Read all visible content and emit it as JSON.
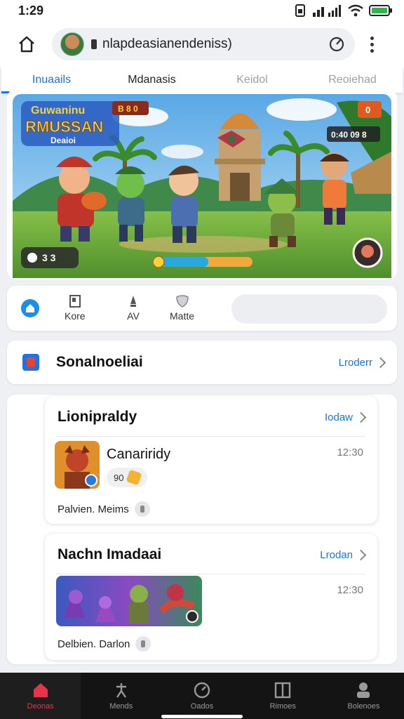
{
  "status_bar": {
    "time": "1:29",
    "icons": [
      "sim-icon",
      "signal-icon",
      "wifi-icon",
      "battery-icon"
    ]
  },
  "browser": {
    "url": "nlapdeasianendeniss)",
    "icons": [
      "home-icon",
      "site-avatar",
      "lock-icon",
      "refresh-icon",
      "more-vert-icon"
    ]
  },
  "tabs": [
    {
      "label": "Inuaails"
    },
    {
      "label": "Mdanasis"
    },
    {
      "label": "Keidol"
    },
    {
      "label": "Reoiehad"
    }
  ],
  "hero": {
    "logo_line1": "Guwaninu",
    "logo_line2": "RMUSSAN",
    "logo_line3": "Deaioi",
    "top_badge": "B 8 0",
    "score_badge": "0:40 09 8",
    "corner_badge": "0",
    "counter_badge": "3 3",
    "progress": 0.55,
    "colors": {
      "sky": "#6fb6e8",
      "grass": "#6aa83a",
      "progress_fill": "#29a8e0",
      "progress_track": "#f2a93b"
    }
  },
  "quick_actions": {
    "items": [
      {
        "label": "Kore",
        "icon": "book-icon"
      },
      {
        "label": "AV",
        "icon": "pen-icon"
      },
      {
        "label": "Matte",
        "icon": "shield-icon"
      }
    ],
    "home_icon": "home-icon",
    "search_placeholder": ""
  },
  "section": {
    "title": "Sonalnoeliai",
    "link": "Lroderr"
  },
  "cards": [
    {
      "title": "Lionipraldy",
      "link": "Iodaw",
      "item_name": "Canariridy",
      "time": "12:30",
      "tag": "90",
      "footer": "Palvien. Meims"
    },
    {
      "title": "Nachn Imadaai",
      "link": "Lrodan",
      "time": "12:30",
      "footer": "Delbien. Darlon"
    }
  ],
  "bottom_nav": [
    {
      "label": "Deonas",
      "icon": "home-icon",
      "active": true
    },
    {
      "label": "Mends",
      "icon": "figure-icon",
      "active": false
    },
    {
      "label": "Oados",
      "icon": "clock-icon",
      "active": false
    },
    {
      "label": "Rimoes",
      "icon": "book-icon",
      "active": false
    },
    {
      "label": "Bolenoes",
      "icon": "person-icon",
      "active": false
    }
  ],
  "colors": {
    "accent": "#1a73e8",
    "nav_active": "#e8334a",
    "nav_background": "#141414"
  }
}
